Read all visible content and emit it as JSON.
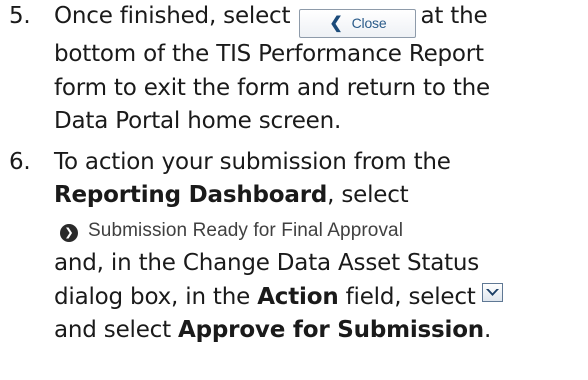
{
  "steps": [
    {
      "number": "5.",
      "text_before_button": "Once finished, select",
      "button_label": "Close",
      "text_after_button": "at the",
      "line2": "bottom of the TIS Performance Report",
      "line3": "form to exit the form and return to the",
      "line4": "Data Portal home screen."
    },
    {
      "number": "6.",
      "line1": "To action your submission from the",
      "bold_dashboard": "Reporting Dashboard",
      "after_dashboard": ", select",
      "status_link_label": "Submission Ready for Final Approval",
      "line4": "and, in the Change Data Asset Status",
      "line5_before": "dialog box, in the",
      "bold_action": "Action",
      "line5_after": "field, select",
      "line6_before": "and select",
      "bold_approve": "Approve for Submission",
      "line6_after": "."
    }
  ],
  "icons": {
    "close_chevron": "chevron-left-icon",
    "status_arrow": "circle-arrow-right-icon",
    "dropdown": "chevron-down-icon"
  },
  "colors": {
    "button_text": "#2b5c8a",
    "button_border": "#8e9baa",
    "link_text": "#404040"
  }
}
